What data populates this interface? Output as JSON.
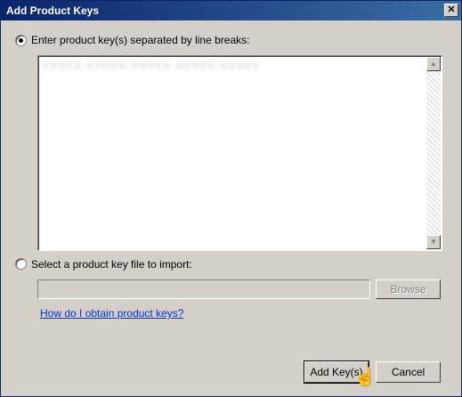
{
  "window": {
    "title": "Add Product Keys",
    "close_glyph": "✕"
  },
  "option_enter": {
    "label": "Enter product key(s) separated by line breaks:",
    "selected": true
  },
  "textarea": {
    "value": "XXXXX-XXXXX-XXXXX-XXXXX-XXXXX",
    "scroll_up": "▲",
    "scroll_down": "▼"
  },
  "option_file": {
    "label": "Select a product key file to import:",
    "selected": false
  },
  "file_input": {
    "value": ""
  },
  "browse_button": {
    "label": "Browse"
  },
  "help_link": {
    "label": "How do I obtain product keys?"
  },
  "add_button": {
    "label": "Add Key(s)"
  },
  "cancel_button": {
    "label": "Cancel"
  },
  "cursor": {
    "icon": "hand-pointer-icon",
    "glyph": "☝"
  }
}
